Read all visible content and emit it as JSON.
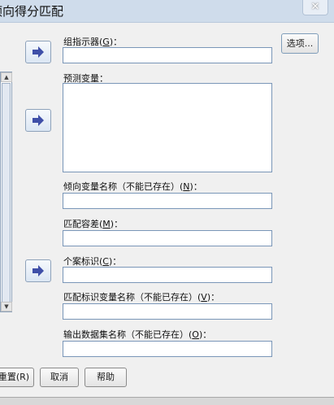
{
  "window": {
    "title": "倾向得分匹配",
    "close_label": "✕"
  },
  "fields": {
    "group_indicator": {
      "label": "组指示器(",
      "mnemonic": "G",
      "suffix": ")：",
      "value": ""
    },
    "predictors": {
      "label": "预测变量：",
      "value": ""
    },
    "propensity_var": {
      "label": "倾向变量名称（不能已存在）(",
      "mnemonic": "N",
      "suffix": ")：",
      "value": ""
    },
    "match_tolerance": {
      "label": "匹配容差(",
      "mnemonic": "M",
      "suffix": ")：",
      "value": ""
    },
    "case_id": {
      "label": "个案标识(",
      "mnemonic": "C",
      "suffix": ")：",
      "value": ""
    },
    "match_id_var": {
      "label": "匹配标识变量名称（不能已存在）(",
      "mnemonic": "V",
      "suffix": ")：",
      "value": ""
    },
    "output_dataset": {
      "label": "输出数据集名称（不能已存在）(",
      "mnemonic": "O",
      "suffix": ")：",
      "value": ""
    }
  },
  "buttons": {
    "options": "选项...",
    "reset": "重置(R)",
    "cancel": "取消",
    "help": "帮助"
  },
  "icons": {
    "move": "arrow-right-icon",
    "close": "close-icon"
  }
}
